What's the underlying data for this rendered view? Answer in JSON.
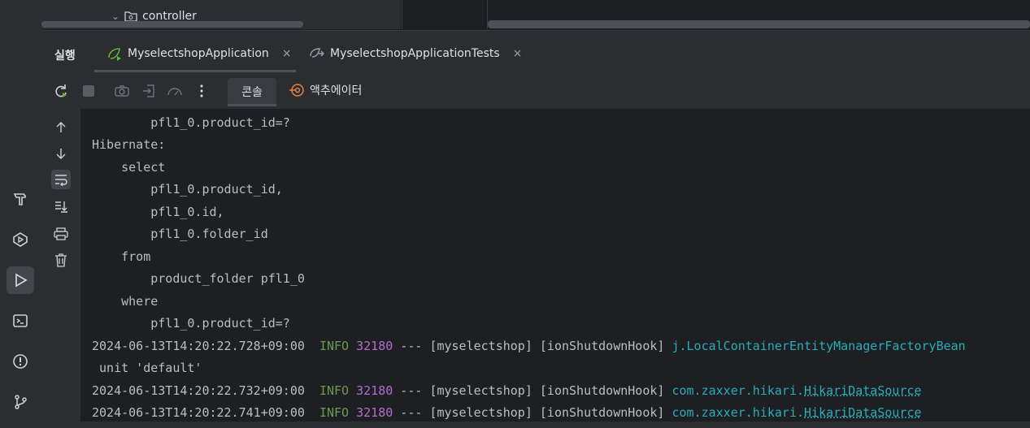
{
  "tree": {
    "folder_label": "controller"
  },
  "run": {
    "title": "실행",
    "tabs": [
      {
        "label": "MyselectshopApplication",
        "close": "×"
      },
      {
        "label": "MyselectshopApplicationTests",
        "close": "×"
      }
    ],
    "subtabs": {
      "console": "콘솔",
      "actuator": "액추에이터"
    }
  },
  "console": {
    "lines": [
      "        pfl1_0.product_id=?",
      "Hibernate: ",
      "    select",
      "        pfl1_0.product_id,",
      "        pfl1_0.id,",
      "        pfl1_0.folder_id",
      "    from",
      "        product_folder pfl1_0",
      "    where",
      "        pfl1_0.product_id=?"
    ],
    "logs": [
      {
        "timestamp": "2024-06-13T14:20:22.728+09:00",
        "level": "INFO",
        "pid": "32180",
        "sep": "---",
        "app": "[myselectshop]",
        "thread": "[ionShutdownHook]",
        "logger_plain": "j.LocalContainerEntityManagerFactoryBean",
        "logger_link": ""
      },
      {
        "timestamp": "2024-06-13T14:20:22.732+09:00",
        "level": "INFO",
        "pid": "32180",
        "sep": "---",
        "app": "[myselectshop]",
        "thread": "[ionShutdownHook]",
        "logger_plain": "com.zaxxer.hikari.",
        "logger_link": "HikariDataSource"
      },
      {
        "timestamp": "2024-06-13T14:20:22.741+09:00",
        "level": "INFO",
        "pid": "32180",
        "sep": "---",
        "app": "[myselectshop]",
        "thread": "[ionShutdownHook]",
        "logger_plain": "com.zaxxer.hikari.",
        "logger_link": "HikariDataSource"
      }
    ],
    "continuation": " unit 'default'"
  },
  "colors": {
    "info": "#6a9b4e",
    "pid": "#b36dd0",
    "logger": "#2aacb8",
    "background": "#1e1f22"
  }
}
